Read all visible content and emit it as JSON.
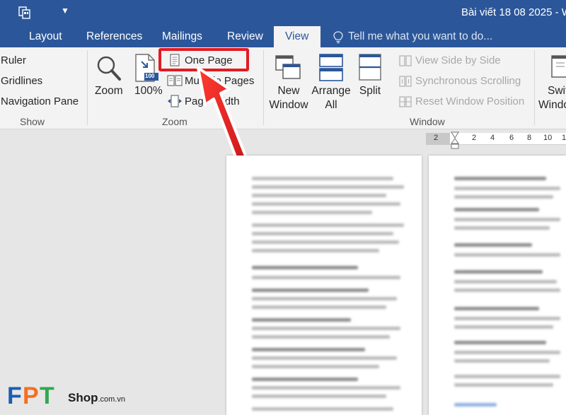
{
  "titlebar": {
    "title": "Bài viết 18 08 2025 - W..."
  },
  "tabs": [
    {
      "label": "Layout"
    },
    {
      "label": "References"
    },
    {
      "label": "Mailings"
    },
    {
      "label": "Review"
    },
    {
      "label": "View"
    }
  ],
  "tellme": {
    "text": "Tell me what you want to do..."
  },
  "ribbon": {
    "show": {
      "ruler": "Ruler",
      "gridlines": "Gridlines",
      "navigation_pane": "Navigation Pane",
      "label": "Show"
    },
    "zoom": {
      "zoom": "Zoom",
      "percent": "100%",
      "percent_badge": "100",
      "one_page": "One Page",
      "multiple_pages": "Multiple Pages",
      "page_width": "Page Width",
      "label": "Zoom"
    },
    "window": {
      "new_window_1": "New",
      "new_window_2": "Window",
      "arrange_all_1": "Arrange",
      "arrange_all_2": "All",
      "split": "Split",
      "view_side_by_side": "View Side by Side",
      "synchronous_scrolling": "Synchronous Scrolling",
      "reset_window_position": "Reset Window Position",
      "label": "Window",
      "switch_1": "Swit",
      "switch_2": "Windo"
    }
  },
  "ruler": {
    "numbers": [
      "2",
      "2",
      "4",
      "6",
      "8",
      "10",
      "1"
    ]
  },
  "watermark": {
    "letters": [
      "F",
      "P",
      "T"
    ],
    "shop": "Shop",
    "domain": ".com.vn"
  },
  "colors": {
    "accent": "#2b579a",
    "highlight": "#e21b22",
    "logo_orange": "#f36f21",
    "logo_blue": "#1b5db3",
    "logo_green": "#2fa84f"
  }
}
